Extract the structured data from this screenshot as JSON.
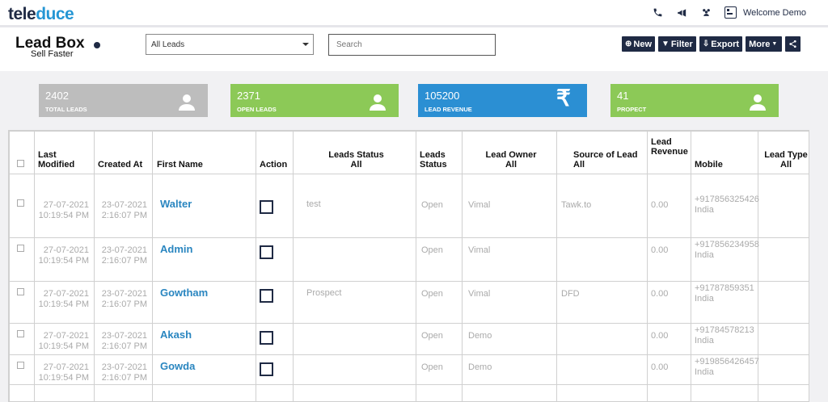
{
  "app": {
    "logo_part1": "tele",
    "logo_part2": "duce",
    "welcome": "Welcome Demo"
  },
  "icons": {
    "phone": "phone-icon",
    "announce": "megaphone-icon",
    "team": "users-icon",
    "user_card": "contact-card-icon"
  },
  "page": {
    "title": "Lead Box",
    "subtitle": "Sell Faster"
  },
  "filter": {
    "selected": "All Leads"
  },
  "search": {
    "placeholder": "Search"
  },
  "toolbar": {
    "new": "New",
    "filter": "Filter",
    "export": "Export",
    "more": "More"
  },
  "cards": [
    {
      "value": "2402",
      "label": "TOTAL LEADS",
      "color": "#bdbdbd",
      "icon": "user-icon"
    },
    {
      "value": "2371",
      "label": "OPEN LEADS",
      "color": "#8cc957",
      "icon": "user-icon"
    },
    {
      "value": "105200",
      "label": "LEAD REVENUE",
      "color": "#2b8fd3",
      "icon": "rupee-icon"
    },
    {
      "value": "41",
      "label": "PROPECT",
      "color": "#8cc957",
      "icon": "user-icon"
    }
  ],
  "table": {
    "headers": {
      "last_modified": "Last Modified",
      "created_at": "Created At",
      "first_name": "First Name",
      "action": "Action",
      "leads_status_filter": "Leads Status",
      "all": "All",
      "leads_status": "Leads Status",
      "lead_owner": "Lead Owner",
      "source": "Source of Lead",
      "revenue": "Lead Revenue",
      "mobile": "Mobile",
      "lead_type": "Lead Type"
    },
    "rows": [
      {
        "modified_date": "27-07-2021",
        "modified_time": "10:19:54 PM",
        "created_date": "23-07-2021",
        "created_time": "2:16:07 PM",
        "name": "Walter",
        "status_note": "test",
        "status": "Open",
        "owner": "Vimal",
        "source": "Tawk.to",
        "revenue": "0.00",
        "mobile": "+917856325426",
        "country": "India"
      },
      {
        "modified_date": "27-07-2021",
        "modified_time": "10:19:54 PM",
        "created_date": "23-07-2021",
        "created_time": "2:16:07 PM",
        "name": "Admin",
        "status_note": "",
        "status": "Open",
        "owner": "Vimal",
        "source": "",
        "revenue": "0.00",
        "mobile": "+917856234958",
        "country": "India"
      },
      {
        "modified_date": "27-07-2021",
        "modified_time": "10:19:54 PM",
        "created_date": "23-07-2021",
        "created_time": "2:16:07 PM",
        "name": "Gowtham",
        "status_note": "Prospect",
        "status": "Open",
        "owner": "Vimal",
        "source": "DFD",
        "revenue": "0.00",
        "mobile": "+91787859351",
        "country": "India"
      },
      {
        "modified_date": "27-07-2021",
        "modified_time": "10:19:54 PM",
        "created_date": "23-07-2021",
        "created_time": "2:16:07 PM",
        "name": "Akash",
        "status_note": "",
        "status": "Open",
        "owner": "Demo",
        "source": "",
        "revenue": "0.00",
        "mobile": "+91784578213",
        "country": "India"
      },
      {
        "modified_date": "27-07-2021",
        "modified_time": "10:19:54 PM",
        "created_date": "23-07-2021",
        "created_time": "2:16:07 PM",
        "name": "Gowda",
        "status_note": "",
        "status": "Open",
        "owner": "Demo",
        "source": "",
        "revenue": "0.00",
        "mobile": "+919856426457",
        "country": "India"
      }
    ]
  }
}
